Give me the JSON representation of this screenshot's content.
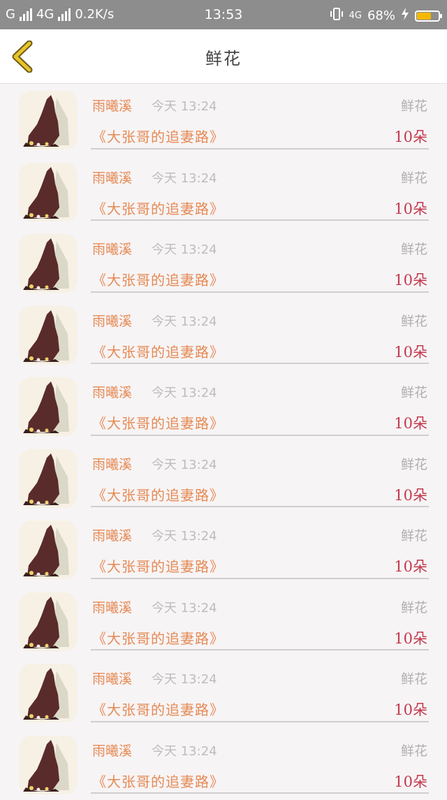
{
  "status": {
    "left_text": "G",
    "network": "4G",
    "speed": "0.2K/s",
    "time": "13:53",
    "network_right": "4G",
    "battery": "68%",
    "battery_level": 0.68,
    "battery_color": "#f5b800"
  },
  "nav": {
    "title": "鲜花"
  },
  "records": [
    {
      "name": "雨曦溪",
      "time": "今天 13:24",
      "category": "鲜花",
      "book": "《大张哥的追妻路》",
      "count": "10朵"
    },
    {
      "name": "雨曦溪",
      "time": "今天 13:24",
      "category": "鲜花",
      "book": "《大张哥的追妻路》",
      "count": "10朵"
    },
    {
      "name": "雨曦溪",
      "time": "今天 13:24",
      "category": "鲜花",
      "book": "《大张哥的追妻路》",
      "count": "10朵"
    },
    {
      "name": "雨曦溪",
      "time": "今天 13:24",
      "category": "鲜花",
      "book": "《大张哥的追妻路》",
      "count": "10朵"
    },
    {
      "name": "雨曦溪",
      "time": "今天 13:24",
      "category": "鲜花",
      "book": "《大张哥的追妻路》",
      "count": "10朵"
    },
    {
      "name": "雨曦溪",
      "time": "今天 13:24",
      "category": "鲜花",
      "book": "《大张哥的追妻路》",
      "count": "10朵"
    },
    {
      "name": "雨曦溪",
      "time": "今天 13:24",
      "category": "鲜花",
      "book": "《大张哥的追妻路》",
      "count": "10朵"
    },
    {
      "name": "雨曦溪",
      "time": "今天 13:24",
      "category": "鲜花",
      "book": "《大张哥的追妻路》",
      "count": "10朵"
    },
    {
      "name": "雨曦溪",
      "time": "今天 13:24",
      "category": "鲜花",
      "book": "《大张哥的追妻路》",
      "count": "10朵"
    },
    {
      "name": "雨曦溪",
      "time": "今天 13:24",
      "category": "鲜花",
      "book": "《大张哥的追妻路》",
      "count": "10朵"
    }
  ],
  "colors": {
    "accent": "#e58a55",
    "count": "#c23a4e",
    "back_icon": "#e8c32a"
  }
}
